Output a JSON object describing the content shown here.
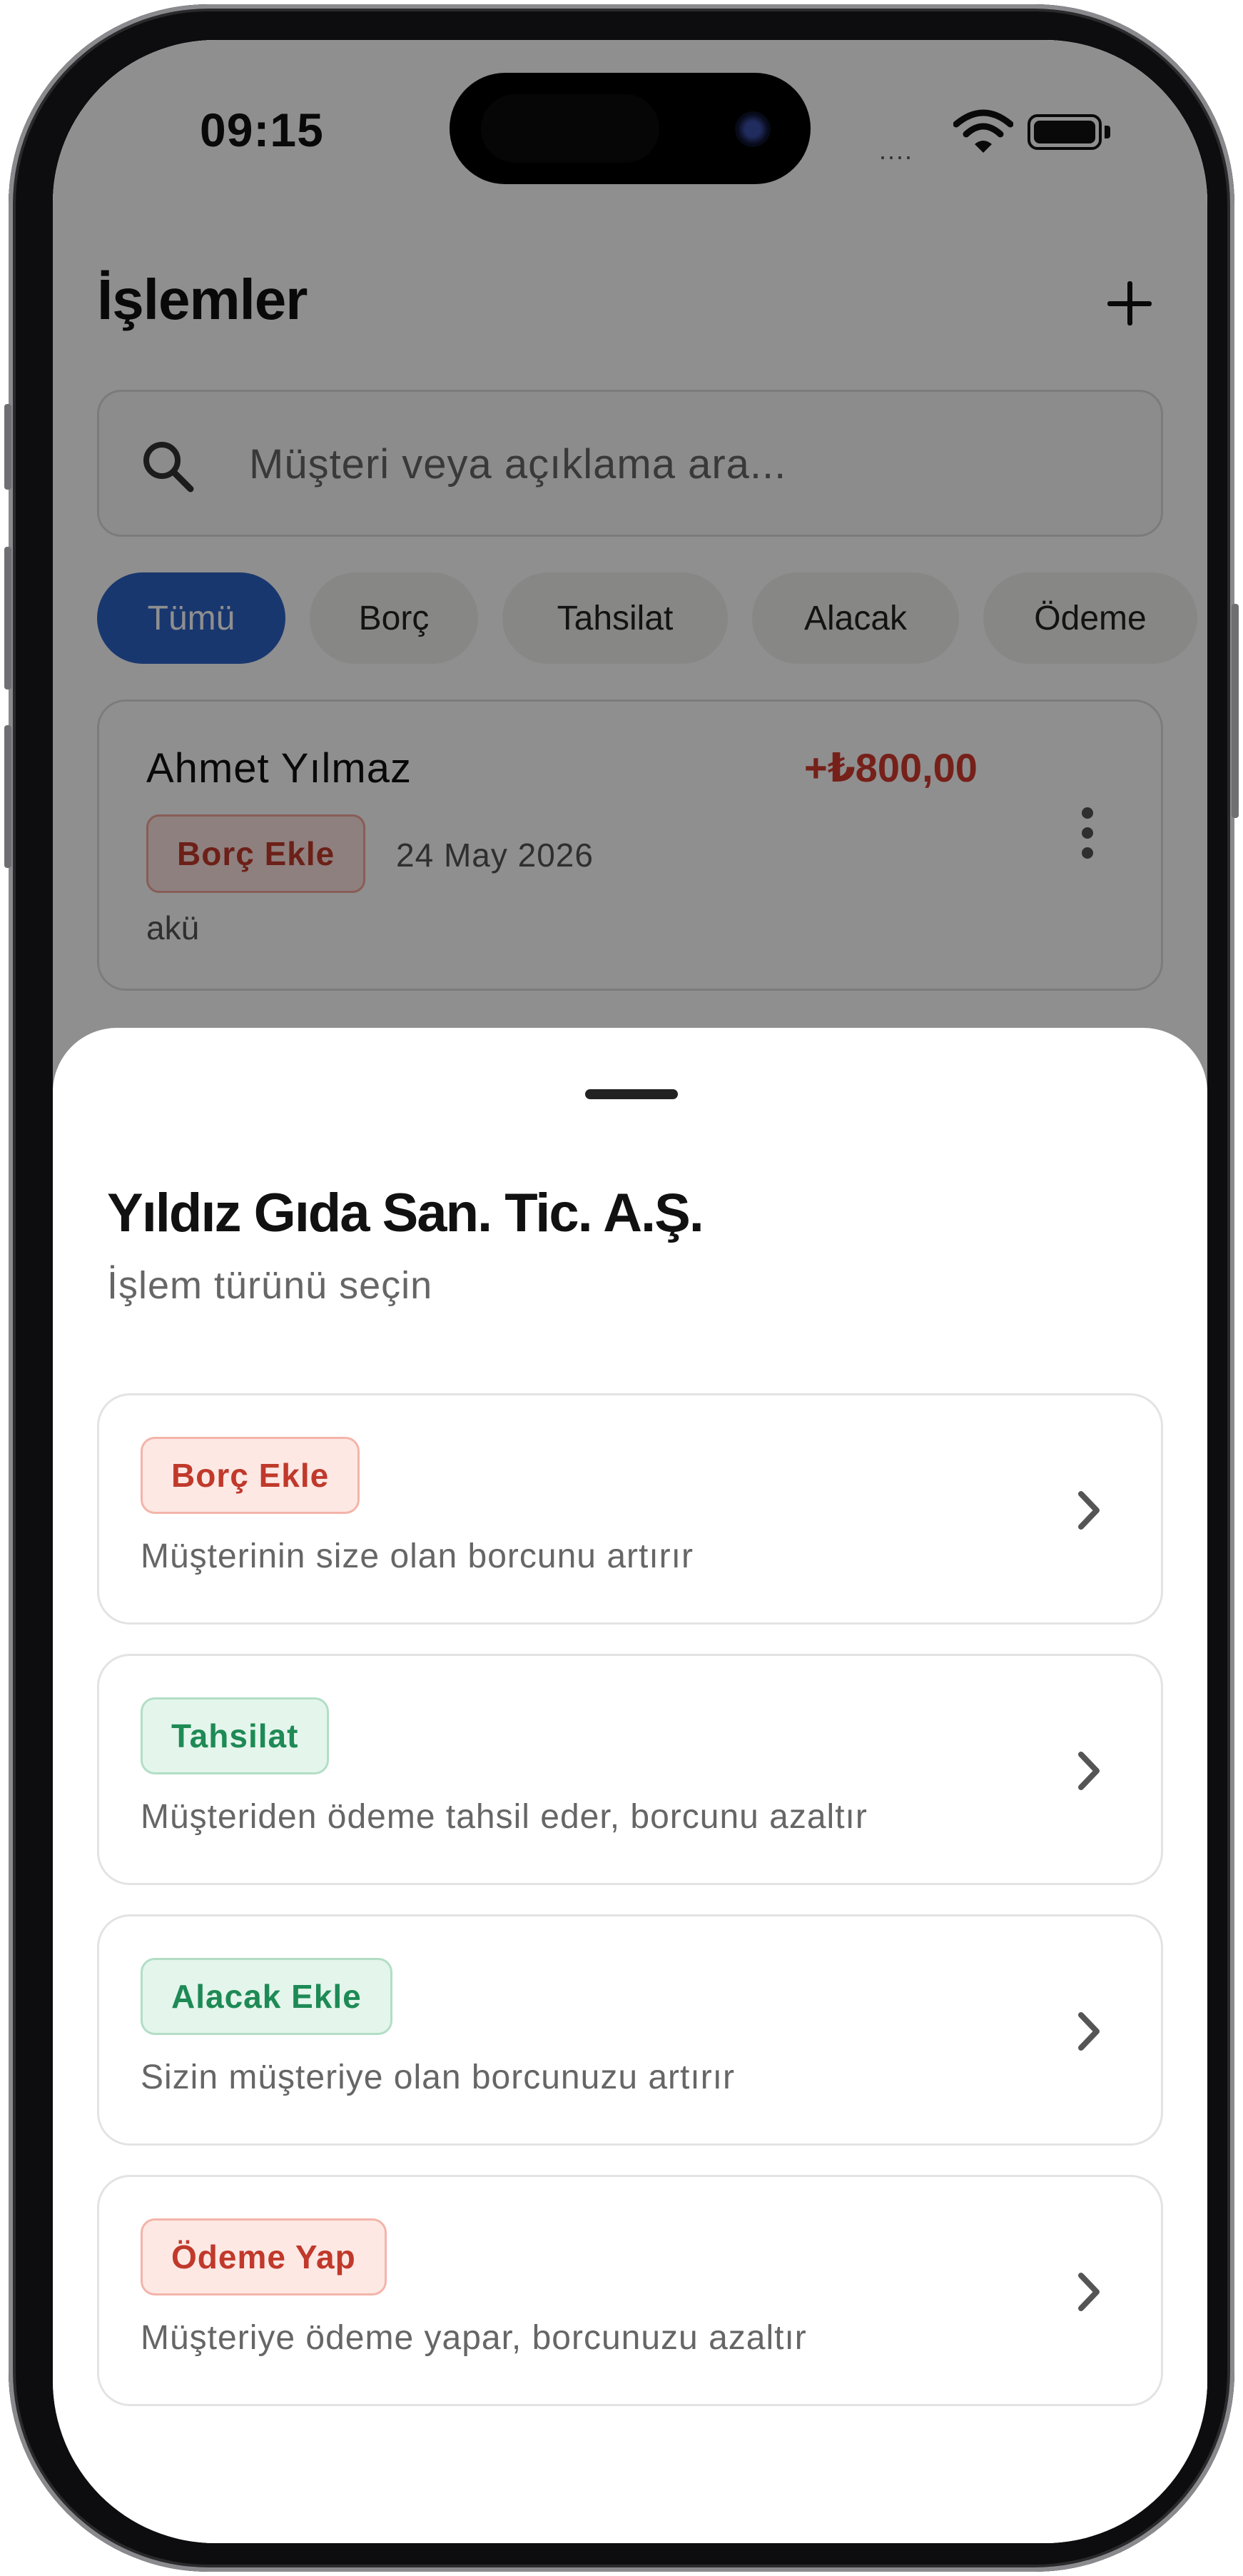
{
  "status": {
    "time": "09:15",
    "signal": "....",
    "icons": [
      "signal-icon",
      "wifi-icon",
      "battery-icon"
    ]
  },
  "app": {
    "title": "İşlemler",
    "add_icon": "plus-icon",
    "search": {
      "icon": "search-icon",
      "placeholder": "Müşteri veya açıklama ara..."
    },
    "filters": [
      {
        "label": "Tümü",
        "selected": true
      },
      {
        "label": "Borç",
        "selected": false
      },
      {
        "label": "Tahsilat",
        "selected": false
      },
      {
        "label": "Alacak",
        "selected": false
      },
      {
        "label": "Ödeme",
        "selected": false
      }
    ],
    "transaction": {
      "name": "Ahmet Yılmaz",
      "amount": "+₺800,00",
      "type": "Borç Ekle",
      "date": "24 May 2026",
      "note": "akü"
    }
  },
  "sheet": {
    "title": "Yıldız Gıda San. Tic. A.Ş.",
    "subtitle": "İşlem türünü seçin",
    "options": [
      {
        "label": "Borç Ekle",
        "description": "Müşterinin size olan borcunu artırır",
        "tone": "red"
      },
      {
        "label": "Tahsilat",
        "description": "Müşteriden ödeme tahsil eder, borcunu azaltır",
        "tone": "green"
      },
      {
        "label": "Alacak Ekle",
        "description": "Sizin müşteriye olan borcunuzu artırır",
        "tone": "green"
      },
      {
        "label": "Ödeme Yap",
        "description": "Müşteriye ödeme yapar, borcunuzu azaltır",
        "tone": "red"
      }
    ]
  },
  "colors": {
    "accent": "#2e63c6",
    "debit": "#c0392b",
    "credit": "#1e8a55",
    "amount": "#d23a2f"
  }
}
